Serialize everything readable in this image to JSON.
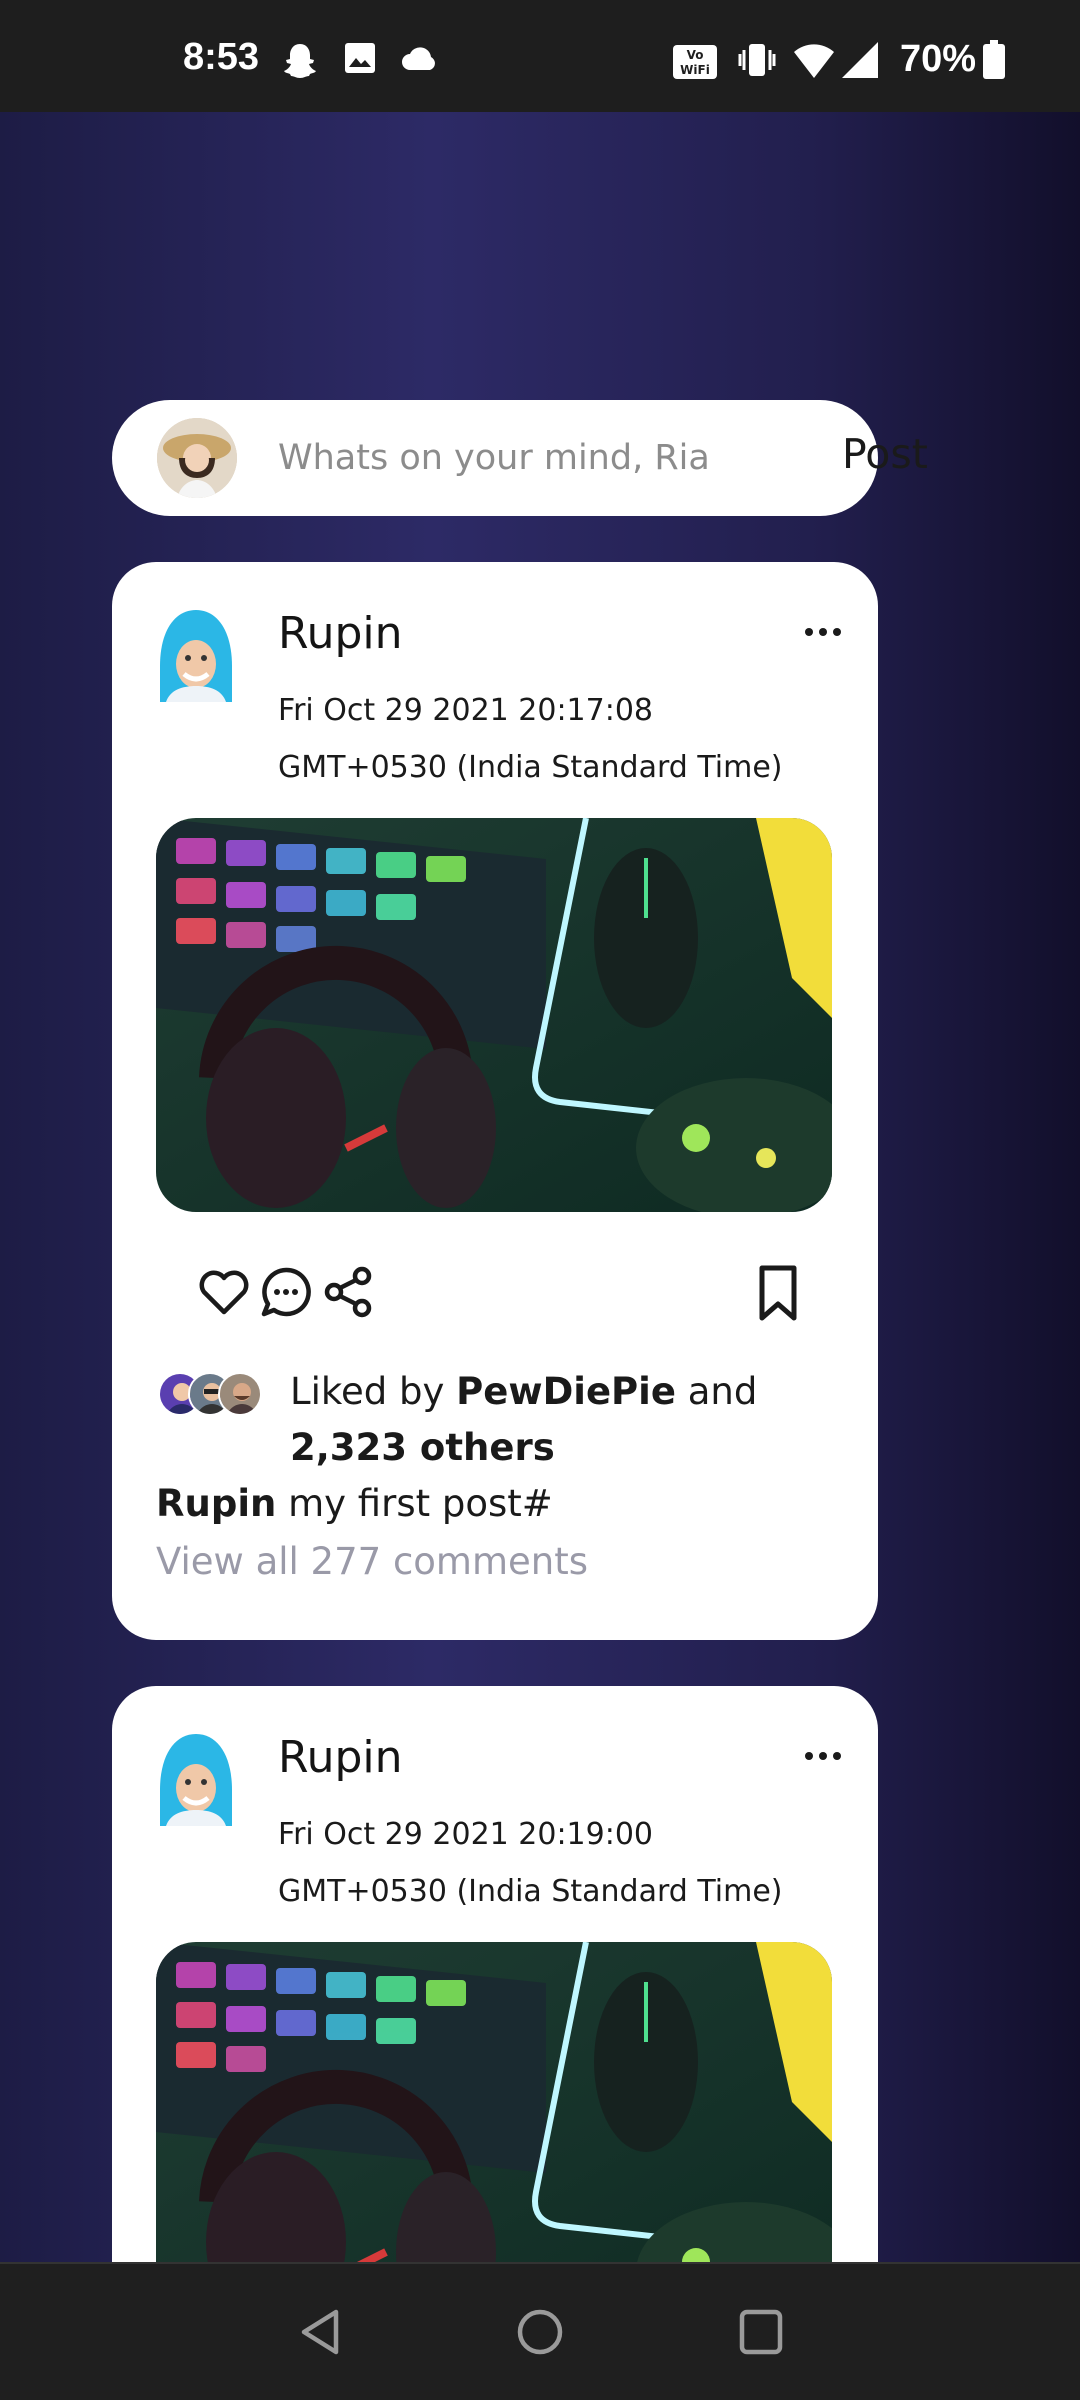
{
  "status_bar": {
    "time": "8:53",
    "battery": "70%",
    "icons": [
      "snapchat-icon",
      "gallery-icon",
      "cloud-icon",
      "vowifi-icon",
      "vibrate-icon",
      "wifi-icon",
      "signal-icon",
      "battery-icon"
    ]
  },
  "composer": {
    "placeholder": "Whats on your mind, Ria",
    "post_label": "Post"
  },
  "posts": [
    {
      "author": "Rupin",
      "timestamp": "Fri Oct 29 2021 20:17:08 GMT+0530 (India Standard Time)",
      "liked_prefix": "Liked by",
      "liked_user": "PewDiePie",
      "liked_and": "and",
      "liked_count": "2,323 others",
      "caption_user": "Rupin",
      "caption_text": "my first post#",
      "view_comments": "View all 277 comments"
    },
    {
      "author": "Rupin",
      "timestamp": "Fri Oct 29 2021 20:19:00 GMT+0530 (India Standard Time)"
    }
  ],
  "colors": {
    "background_accent": "#2d2a66",
    "card": "#ffffff",
    "muted_text": "#9a9aa8"
  }
}
